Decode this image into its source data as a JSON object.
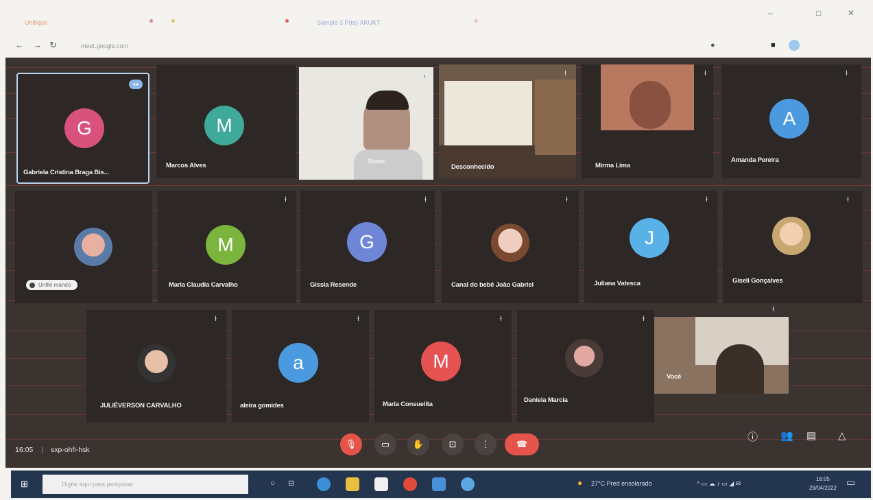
{
  "browser": {
    "tabs": [
      "Unifique",
      "Sample 3 P(te) XKUKT"
    ],
    "url": "meet.google.com",
    "window_controls": [
      "–",
      "□",
      "✕"
    ]
  },
  "participants": [
    {
      "name": "Gabriela Cristina Braga Bis...",
      "initial": "G",
      "color": "#d9527e",
      "type": "avatar",
      "selected": true
    },
    {
      "name": "Marcos Alves",
      "initial": "M",
      "color": "#3fa99a",
      "type": "avatar"
    },
    {
      "name": "Sianei",
      "type": "video"
    },
    {
      "name": "Desconhecido",
      "type": "video"
    },
    {
      "name": "Mirma Lima",
      "type": "video"
    },
    {
      "name": "Amanda Pereira",
      "initial": "A",
      "color": "#4b9ae0",
      "type": "avatar"
    },
    {
      "name": "",
      "type": "photo",
      "chip": "Unfile mando"
    },
    {
      "name": "Maria Claudia Carvalho",
      "initial": "M",
      "color": "#7bb53e",
      "type": "avatar"
    },
    {
      "name": "Gissla Resende",
      "initial": "G",
      "color": "#6f86d6",
      "type": "avatar"
    },
    {
      "name": "Canal do bebê João Gabriel",
      "type": "photo"
    },
    {
      "name": "Juliana Vatesca",
      "initial": "J",
      "color": "#58b2e8",
      "type": "avatar"
    },
    {
      "name": "Giseli Gonçalves",
      "type": "photo"
    },
    {
      "name": "JULIÉVERSON CARVALHO",
      "type": "photo"
    },
    {
      "name": "aleira gomides",
      "initial": "a",
      "color": "#4b9ae0",
      "type": "avatar"
    },
    {
      "name": "Maria Consuelita",
      "initial": "M",
      "color": "#e55252",
      "type": "avatar"
    },
    {
      "name": "Daniela Marcia",
      "type": "photo"
    },
    {
      "name": "Você",
      "type": "video"
    }
  ],
  "meeting": {
    "time": "16:05",
    "code": "sxp-ohfi-hsk"
  },
  "taskbar": {
    "search_placeholder": "Digite aqui para pesquisar",
    "weather": "27°C  Pred ensolarado",
    "time": "16:05",
    "date": "29/04/2022"
  }
}
